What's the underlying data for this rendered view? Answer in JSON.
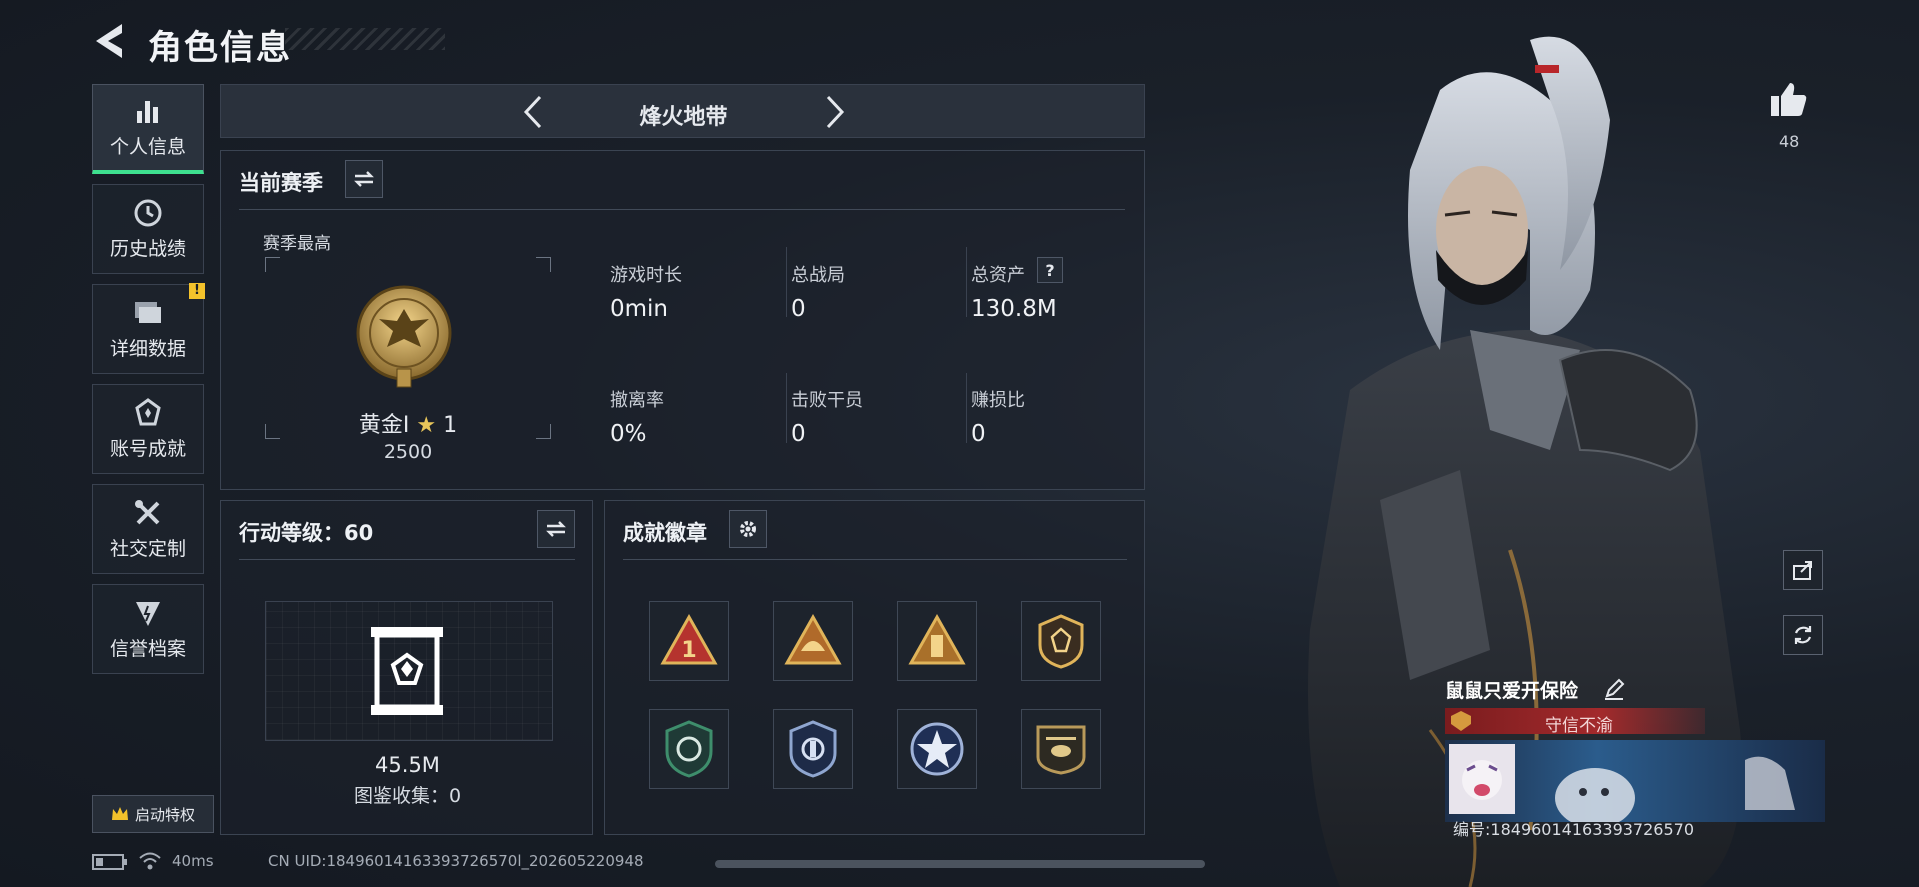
{
  "header": {
    "title": "角色信息"
  },
  "nav": {
    "items": [
      {
        "label": "个人信息",
        "icon": "bar-chart-icon",
        "active": true
      },
      {
        "label": "历史战绩",
        "icon": "clock-icon"
      },
      {
        "label": "详细数据",
        "icon": "folder-icon",
        "badge": "!"
      },
      {
        "label": "账号成就",
        "icon": "achievement-icon"
      },
      {
        "label": "社交定制",
        "icon": "tools-icon"
      },
      {
        "label": "信誉档案",
        "icon": "reputation-icon"
      }
    ],
    "privilege_label": "启动特权"
  },
  "mode": {
    "title": "烽火地带"
  },
  "season": {
    "title": "当前赛季",
    "best_label": "赛季最高",
    "rank_name": "黄金I",
    "rank_stars": "1",
    "rank_score": "2500",
    "stats": [
      {
        "label": "游戏时长",
        "value": "0min"
      },
      {
        "label": "总战局",
        "value": "0"
      },
      {
        "label": "总资产",
        "value": "130.8M",
        "help": "?"
      },
      {
        "label": "撤离率",
        "value": "0%"
      },
      {
        "label": "击败干员",
        "value": "0"
      },
      {
        "label": "赚损比",
        "value": "0"
      }
    ]
  },
  "action_level": {
    "label": "行动等级：",
    "value": "60",
    "value_text": "45.5M",
    "collection_label": "图鉴收集：",
    "collection_value": "0"
  },
  "achievements": {
    "title": "成就徽章",
    "badges": [
      "rank-one-badge",
      "helmet-badge",
      "tower-badge",
      "diamond-shield-badge",
      "green-shield-badge",
      "police-badge",
      "star-badge",
      "helicopter-badge"
    ]
  },
  "player": {
    "likes": "48",
    "name": "鼠鼠只爱开保险",
    "title": "守信不渝",
    "id_label": "编号:",
    "id_value": "18496014163393726570"
  },
  "status": {
    "ping": "40ms",
    "uid": "CN UID:18496014163393726570l_202605220948"
  },
  "colors": {
    "accent": "#3ee08f",
    "badge": "#f3c22b",
    "title_red": "#a32a2c"
  }
}
